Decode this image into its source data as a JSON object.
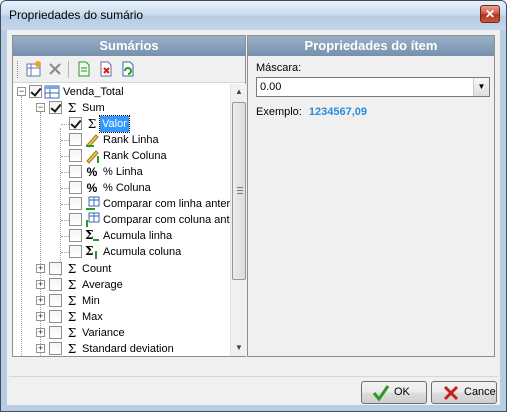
{
  "window": {
    "title": "Propriedades do sumário",
    "close_glyph": "✕"
  },
  "left_panel": {
    "header": "Sumários",
    "toolbar": [
      {
        "name": "add-summary-icon"
      },
      {
        "name": "delete-icon"
      },
      {
        "name": "new-document-icon"
      },
      {
        "name": "remove-document-icon"
      },
      {
        "name": "refresh-icon"
      }
    ]
  },
  "tree": {
    "root": "Venda_Total",
    "sum": "Sum",
    "valor": "Valor",
    "rank_linha": "Rank Linha",
    "rank_coluna": "Rank Coluna",
    "pct_linha": "% Linha",
    "pct_coluna": "% Coluna",
    "comparar_linha": "Comparar com linha anterior",
    "comparar_coluna": "Comparar com coluna anterior",
    "acumula_linha": "Acumula linha",
    "acumula_coluna": "Acumula coluna",
    "count": "Count",
    "average": "Average",
    "min": "Min",
    "max": "Max",
    "variance": "Variance",
    "stddev": "Standard deviation",
    "sigma": "Σ",
    "percent": "%"
  },
  "right_panel": {
    "header": "Propriedades do ítem",
    "mask_label": "Máscara:",
    "mask_value": "0.00",
    "example_label": "Exemplo:",
    "example_value": "1234567,09"
  },
  "buttons": {
    "ok": "OK",
    "cancel": "Cancelar"
  },
  "colors": {
    "accent": "#2a8cdc",
    "selection": "#3399ff",
    "header": "#7590ad"
  }
}
